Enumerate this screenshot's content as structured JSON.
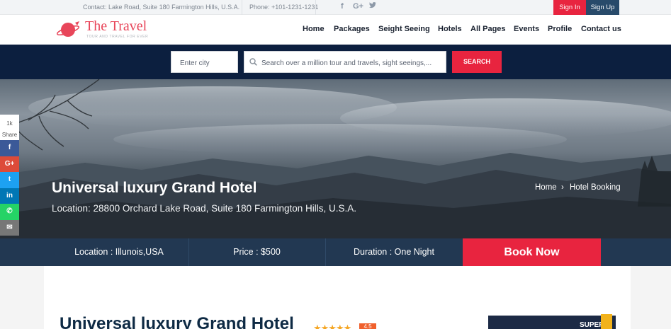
{
  "topbar": {
    "contact": "Contact: Lake Road, Suite 180 Farmington Hills, U.S.A.",
    "phone": "Phone: +101-1231-1231",
    "social_icons": [
      "facebook-icon",
      "google-plus-icon",
      "twitter-icon"
    ],
    "signin_label": "Sign In",
    "signup_label": "Sign Up"
  },
  "header": {
    "logo_title": "The Travel",
    "logo_tagline": "TOUR AND TRAVEL FOR EVER",
    "nav": [
      "Home",
      "Packages",
      "Seight Seeing",
      "Hotels",
      "All Pages",
      "Events",
      "Profile",
      "Contact us"
    ]
  },
  "search": {
    "city_placeholder": "Enter city",
    "query_placeholder": "Search over a million tour and travels, sight seeings,...",
    "button_label": "SEARCH"
  },
  "hero": {
    "title": "Universal luxury Grand Hotel",
    "location": "Location: 28800 Orchard Lake Road, Suite 180 Farmington Hills, U.S.A.",
    "breadcrumb": {
      "home": "Home",
      "separator": "›",
      "current": "Hotel Booking"
    }
  },
  "share": {
    "count": "1k",
    "label": "Share",
    "buttons": [
      {
        "icon": "facebook-icon",
        "glyph": "f",
        "color": "#3b5998"
      },
      {
        "icon": "google-plus-icon",
        "glyph": "G+",
        "color": "#dd4b39"
      },
      {
        "icon": "twitter-icon",
        "glyph": "t",
        "color": "#1da1f2"
      },
      {
        "icon": "linkedin-icon",
        "glyph": "in",
        "color": "#0077b5"
      },
      {
        "icon": "whatsapp-icon",
        "glyph": "✆",
        "color": "#25d366"
      },
      {
        "icon": "mail-icon",
        "glyph": "✉",
        "color": "#777777"
      }
    ]
  },
  "infobar": {
    "location": "Location : Illunois,USA",
    "price": "Price : $500",
    "duration": "Duration : One Night",
    "book_label": "Book Now"
  },
  "content": {
    "title": "Universal luxury Grand Hotel",
    "stars": "★★★★★",
    "rating": "4.5",
    "ad_text": "SUPER"
  },
  "colors": {
    "accent": "#e8243f",
    "navy": "#0c1f3f",
    "infobar": "#223852"
  }
}
